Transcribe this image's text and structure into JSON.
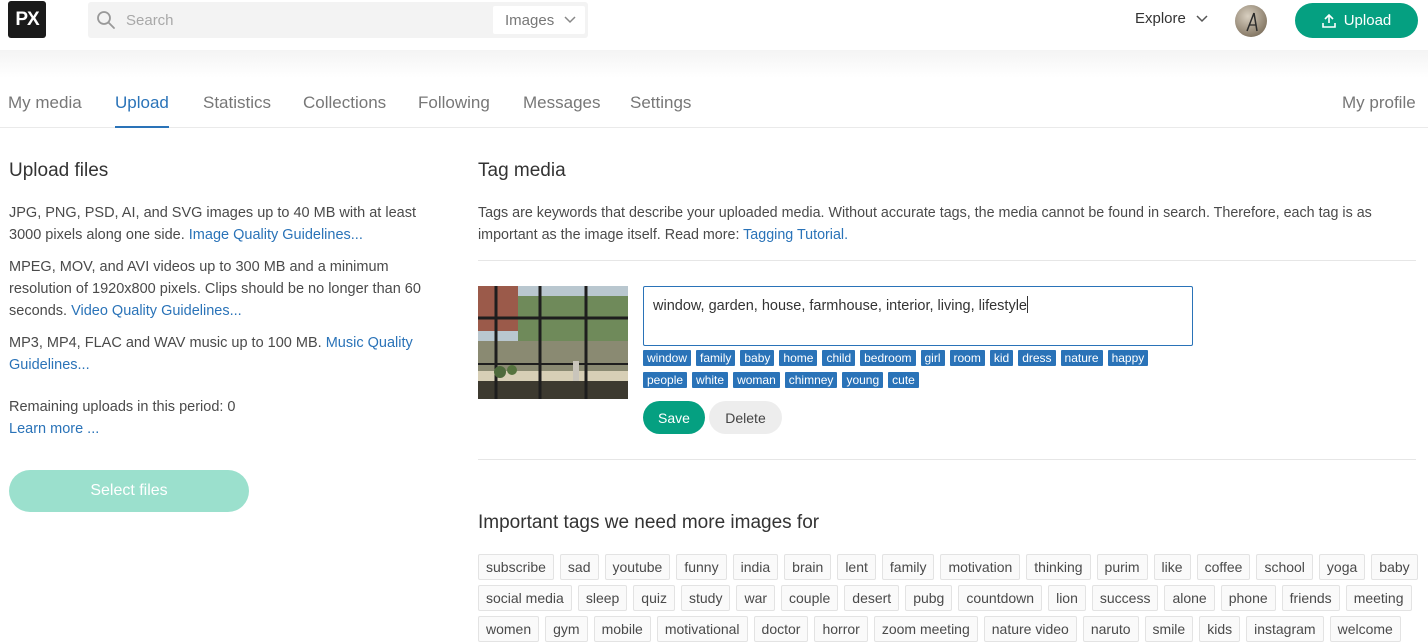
{
  "header": {
    "logo_text": "PX",
    "search_placeholder": "Search",
    "search_type": "Images",
    "explore_label": "Explore",
    "upload_label": "Upload"
  },
  "tabs": [
    {
      "label": "My media"
    },
    {
      "label": "Upload",
      "active": true
    },
    {
      "label": "Statistics"
    },
    {
      "label": "Collections"
    },
    {
      "label": "Following"
    },
    {
      "label": "Messages"
    },
    {
      "label": "Settings"
    }
  ],
  "my_profile_label": "My profile",
  "upload_files": {
    "title": "Upload files",
    "image_text": "JPG, PNG, PSD, AI, and SVG images up to 40 MB with at least 3000 pixels along one side.",
    "image_link": "Image Quality Guidelines...",
    "video_text": "MPEG, MOV, and AVI videos up to 300 MB and a minimum resolution of 1920x800 pixels. Clips should be no longer than 60 seconds.",
    "video_link": "Video Quality Guidelines...",
    "music_text": "MP3, MP4, FLAC and WAV music up to 100 MB.",
    "music_link": "Music Quality Guidelines...",
    "remaining_text": "Remaining uploads in this period: 0",
    "learn_more": "Learn more ...",
    "select_button": "Select files"
  },
  "tag_media": {
    "title": "Tag media",
    "description": "Tags are keywords that describe your uploaded media. Without accurate tags, the media cannot be found in search. Therefore, each tag is as important as the image itself. Read more:",
    "tutorial_link": "Tagging Tutorial.",
    "input_value": "window, garden, house, farmhouse, interior, living, lifestyle",
    "suggested_row1": [
      "window",
      "family",
      "baby",
      "home",
      "child",
      "bedroom",
      "girl",
      "room",
      "kid",
      "dress",
      "nature",
      "happy"
    ],
    "suggested_row2": [
      "people",
      "white",
      "woman",
      "chimney",
      "young",
      "cute"
    ],
    "save_label": "Save",
    "delete_label": "Delete"
  },
  "important_tags": {
    "title": "Important tags we need more images for",
    "row1": [
      "subscribe",
      "sad",
      "youtube",
      "funny",
      "india",
      "brain",
      "lent",
      "family",
      "motivation",
      "thinking",
      "purim",
      "like",
      "coffee",
      "school",
      "yoga",
      "baby"
    ],
    "row2": [
      "social media",
      "sleep",
      "quiz",
      "study",
      "war",
      "couple",
      "desert",
      "pubg",
      "countdown",
      "lion",
      "success",
      "alone",
      "phone",
      "friends",
      "meeting"
    ],
    "row3": [
      "women",
      "gym",
      "mobile",
      "motivational",
      "doctor",
      "horror",
      "zoom meeting",
      "nature video",
      "naruto",
      "smile",
      "kids",
      "instagram",
      "welcome"
    ]
  },
  "colors": {
    "brand_green": "#05a081",
    "link_blue": "#2a73b8",
    "disabled_green": "#9be0cd"
  }
}
